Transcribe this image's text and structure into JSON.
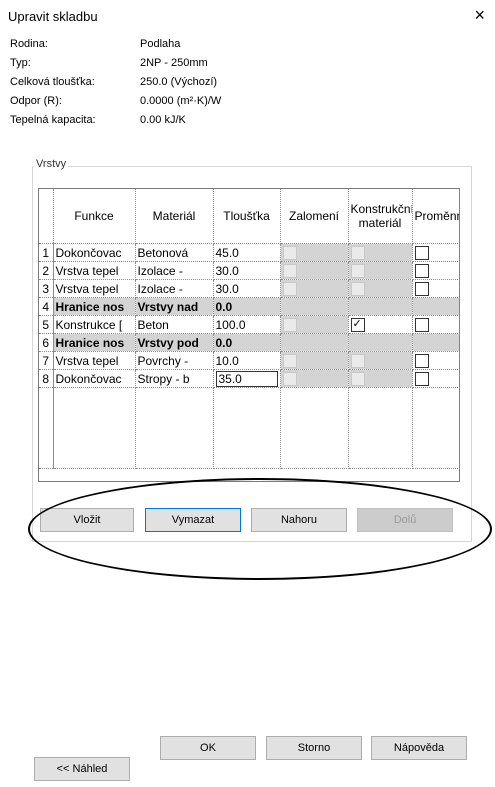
{
  "window": {
    "title": "Upravit skladbu",
    "close_label": "×"
  },
  "info": [
    {
      "label": "Rodina:",
      "value": "Podlaha"
    },
    {
      "label": "Typ:",
      "value": "2NP - 250mm"
    },
    {
      "label": "Celková tloušťka:",
      "value": "250.0 (Výchozí)"
    },
    {
      "label": "Odpor (R):",
      "value": "0.0000 (m²·K)/W"
    },
    {
      "label": "Tepelná kapacita:",
      "value": "0.00 kJ/K"
    }
  ],
  "layers_group": {
    "legend": "Vrstvy"
  },
  "table": {
    "headers": {
      "funkce": "Funkce",
      "material": "Materiál",
      "tloustka": "Tloušťka",
      "zalomeni": "Zalomení",
      "konstrukcni": "Konstrukční materiál",
      "promenna": "Proměnná"
    },
    "rows": [
      {
        "num": "1",
        "funkce": "Dokončovac",
        "material": "Betonová",
        "tloustka": "45.0"
      },
      {
        "num": "2",
        "funkce": "Vrstva tepel",
        "material": "Izolace -",
        "tloustka": "30.0"
      },
      {
        "num": "3",
        "funkce": "Vrstva tepel",
        "material": "Izolace -",
        "tloustka": "30.0"
      },
      {
        "num": "4",
        "funkce": "Hranice nos",
        "material": "Vrstvy nad",
        "tloustka": "0.0"
      },
      {
        "num": "5",
        "funkce": "Konstrukce [",
        "material": "Beton",
        "tloustka": "100.0"
      },
      {
        "num": "6",
        "funkce": "Hranice nos",
        "material": "Vrstvy pod",
        "tloustka": "0.0"
      },
      {
        "num": "7",
        "funkce": "Vrstva tepel",
        "material": "Povrchy -",
        "tloustka": "10.0"
      },
      {
        "num": "8",
        "funkce": "Dokončovac",
        "material": "Stropy - b",
        "tloustka": "35.0"
      }
    ]
  },
  "layer_buttons": {
    "insert": "Vložit",
    "delete": "Vymazat",
    "up": "Nahoru",
    "down": "Dolů"
  },
  "footer_buttons": {
    "ok": "OK",
    "cancel": "Storno",
    "help": "Nápověda",
    "preview": "<< Náhled"
  }
}
